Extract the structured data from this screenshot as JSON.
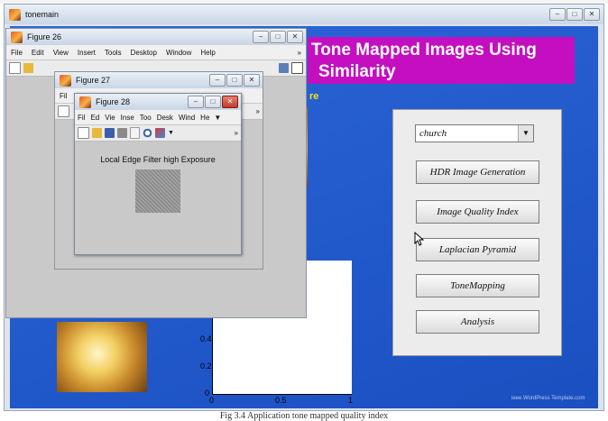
{
  "colors": {
    "app_bg": "#1d55c8",
    "banner_bg": "#c40fc0",
    "banner_text": "#ffffff",
    "subtitle_text": "#f6e21a",
    "panel_bg": "#ececec",
    "figure_bg": "#c9c9c9"
  },
  "app_window": {
    "title": "tonemain",
    "banner_line1": "Tone Mapped Images Using",
    "banner_line2": "Similarity",
    "subtitle_fragment": "re",
    "window_controls": [
      "minimize-icon",
      "maximize-icon",
      "close-icon"
    ]
  },
  "control_panel": {
    "select_value": "church",
    "buttons": [
      "HDR Image Generation",
      "Image Quality Index",
      "Laplacian Pyramid",
      "ToneMapping",
      "Analysis"
    ]
  },
  "plot": {
    "y_ticks": [
      "0.4",
      "0.2",
      "0"
    ],
    "x_ticks": [
      "0",
      "0.5",
      "1"
    ]
  },
  "watermark": "ieee.WordPress Template.com",
  "caption": "Fig 3.4 Application tone mapped quality index",
  "figure26": {
    "title": "Figure 26",
    "menu": [
      "File",
      "Edit",
      "View",
      "Insert",
      "Tools",
      "Desktop",
      "Window",
      "Help"
    ]
  },
  "figure27": {
    "title": "Figure 27",
    "menu": [
      "Fil"
    ]
  },
  "figure28": {
    "title": "Figure 28",
    "menu": [
      "Fil",
      "Ed",
      "Vie",
      "Inse",
      "Too",
      "Desk",
      "Wind",
      "He"
    ],
    "caption": "Local Edge Filter high Exposure"
  }
}
